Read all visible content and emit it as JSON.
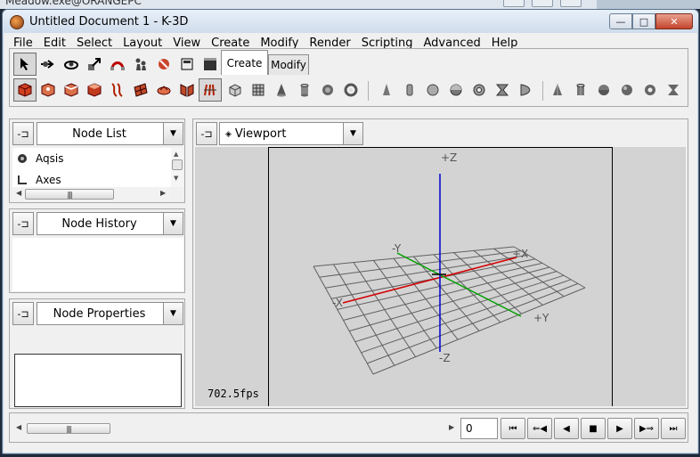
{
  "background_window": {
    "title": "Meadow.exe@ORANGEPC"
  },
  "window": {
    "title": "Untitled Document 1 - K-3D",
    "buttons": {
      "minimize": "—",
      "maximize": "□",
      "close": "✕"
    }
  },
  "menu": [
    "File",
    "Edit",
    "Select",
    "Layout",
    "View",
    "Create",
    "Modify",
    "Render",
    "Scripting",
    "Advanced",
    "Help"
  ],
  "toolbar": {
    "tabs": {
      "create": "Create",
      "modify": "Modify"
    },
    "row1_tools": [
      "select-tool-icon",
      "move-tool-icon",
      "rotate-tool-icon",
      "scale-tool-icon",
      "snap-tool-icon",
      "parent-tool-icon",
      "unparent-tool-icon",
      "render-preview-icon",
      "render-animation-icon"
    ],
    "row2_tools": [
      "select-nodes-icon",
      "select-points-icon",
      "select-lines-icon",
      "select-faces-icon",
      "curve-icon",
      "patch-icon",
      "bone-icon",
      "mesh-icon",
      "sculpt-icon"
    ],
    "primitives_a": [
      "cube-icon",
      "grid-icon",
      "cone-icon",
      "cylinder-icon",
      "disk-icon",
      "torus-icon"
    ],
    "primitives_b": [
      "quadric-cone-icon",
      "quadric-cylinder-icon",
      "quadric-disk-icon",
      "quadric-sphere-icon",
      "quadric-torus-icon",
      "quadric-hyperboloid-icon",
      "quadric-paraboloid-icon"
    ],
    "primitives_c": [
      "poly-cone-icon",
      "poly-cylinder-icon",
      "poly-disk-icon",
      "poly-sphere-icon",
      "poly-torus-icon",
      "poly-hyperboloid-icon"
    ]
  },
  "panels": {
    "node_list": {
      "title": "Node List",
      "items": [
        {
          "label": "Aqsis",
          "icon": "render-engine-icon"
        },
        {
          "label": "Axes",
          "icon": "axes-icon"
        }
      ]
    },
    "node_history": {
      "title": "Node History"
    },
    "node_properties": {
      "title": "Node Properties"
    },
    "viewport": {
      "title": "Viewport"
    }
  },
  "viewport": {
    "fps": "702.5fps",
    "axis_labels": {
      "pz": "+Z",
      "nz": "-Z",
      "px": "+X",
      "nx": "-X",
      "py": "+Y",
      "ny": "-Y"
    },
    "colors": {
      "x_axis": "#d40000",
      "y_axis": "#00a000",
      "z_axis": "#0000d0",
      "grid": "#606060"
    }
  },
  "timeline": {
    "frame": "0"
  }
}
